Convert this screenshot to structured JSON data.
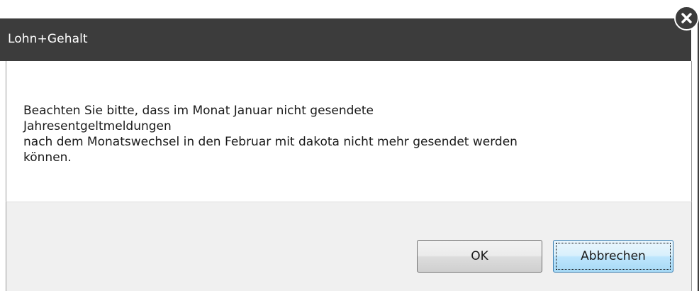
{
  "window": {
    "title": "Lohn+Gehalt"
  },
  "message": {
    "lines": [
      "Beachten Sie bitte, dass im Monat Januar nicht gesendete",
      "Jahresentgeltmeldungen",
      "nach dem Monatswechsel in den Februar mit dakota nicht mehr gesendet werden",
      "können."
    ]
  },
  "buttons": {
    "ok_label": "OK",
    "cancel_label": "Abbrechen"
  },
  "icons": {
    "close": "close-icon"
  },
  "colors": {
    "titlebar": "#3c3c3c",
    "footer": "#f0f0f0",
    "default_button_border": "#3c7fb1"
  }
}
